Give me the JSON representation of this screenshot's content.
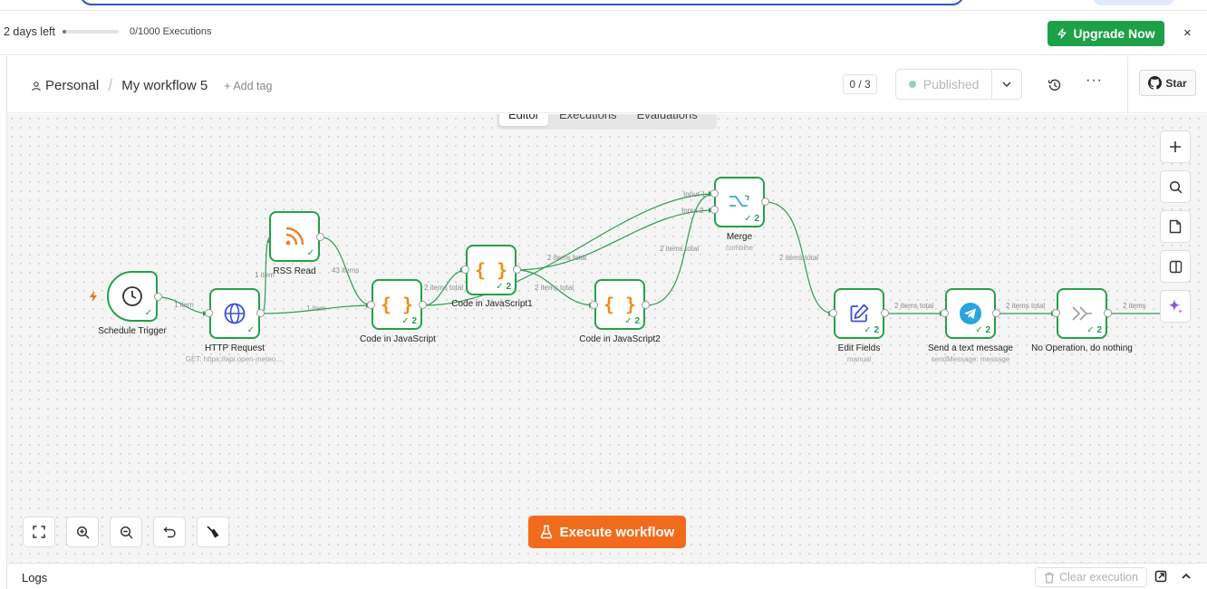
{
  "trial": {
    "days_left": "2 days left",
    "executions": "0/1000 Executions",
    "executions_used_fraction": 0.0,
    "upgrade_label": "Upgrade Now",
    "close_symbol": "×"
  },
  "header": {
    "project": "Personal",
    "breadcrumb_separator": "/",
    "workflow_name": "My workflow 5",
    "add_tag": "+ Add tag",
    "version_count": "0 / 3",
    "publish_label": "Published",
    "more_label": "···",
    "star_label": "Star"
  },
  "tabs": [
    {
      "label": "Editor",
      "active": true
    },
    {
      "label": "Executions",
      "active": false
    },
    {
      "label": "Evaluations",
      "active": false
    }
  ],
  "nodes": {
    "schedule": {
      "label": "Schedule Trigger"
    },
    "http": {
      "label": "HTTP Request",
      "sub": "GET: https://api.open-meteo...."
    },
    "rss": {
      "label": "RSS Read"
    },
    "code": {
      "label": "Code in JavaScript",
      "count": "2"
    },
    "code1": {
      "label": "Code in JavaScript1",
      "count": "2"
    },
    "code2": {
      "label": "Code in JavaScript2",
      "count": "2"
    },
    "merge": {
      "label": "Merge",
      "sub": "combine",
      "count": "2",
      "input1": "Input 1",
      "input2": "Input 2"
    },
    "edit": {
      "label": "Edit Fields",
      "sub": "manual",
      "count": "2"
    },
    "telegram": {
      "label": "Send a text message",
      "sub": "sendMessage: message",
      "count": "2"
    },
    "noop": {
      "label": "No Operation, do nothing",
      "count": "2"
    }
  },
  "edges": {
    "sched_http": "1 item",
    "http_rss": "1 item",
    "http_code": "1 item",
    "rss_code": "43 items",
    "code_code1": "2 items total",
    "code1_code2": "2 items total",
    "code1_merge": "2 items total",
    "code2_merge": "2 items total",
    "merge_edit": "2 items total",
    "edit_tele": "2 items total",
    "tele_noop": "2 items total",
    "noop_out": "2 items"
  },
  "execute_label": "Execute workflow",
  "logs": {
    "title": "Logs",
    "clear_label": "Clear execution"
  },
  "colors": {
    "success_green": "#24a148",
    "upgrade_green": "#1da047",
    "execute_orange": "#f26b1d",
    "code_orange": "#f08c1a",
    "rss_orange": "#f28021",
    "http_blue": "#3d4fd6",
    "telegram_blue": "#2aa3df",
    "merge_teal": "#3fa8c4"
  },
  "icons": [
    "person-icon",
    "bolt-icon",
    "clock-icon",
    "globe-icon",
    "rss-icon",
    "braces-icon",
    "merge-icon",
    "pencil-icon",
    "telegram-icon",
    "arrow-right-icon",
    "plus-icon",
    "search-icon",
    "sticky-note-icon",
    "panel-icon",
    "sparkle-icon",
    "fit-view-icon",
    "zoom-in-icon",
    "zoom-out-icon",
    "undo-icon",
    "broom-icon",
    "flask-icon",
    "trash-icon",
    "popout-icon",
    "chevron-up-icon",
    "chevron-down-icon",
    "history-icon",
    "github-icon"
  ]
}
